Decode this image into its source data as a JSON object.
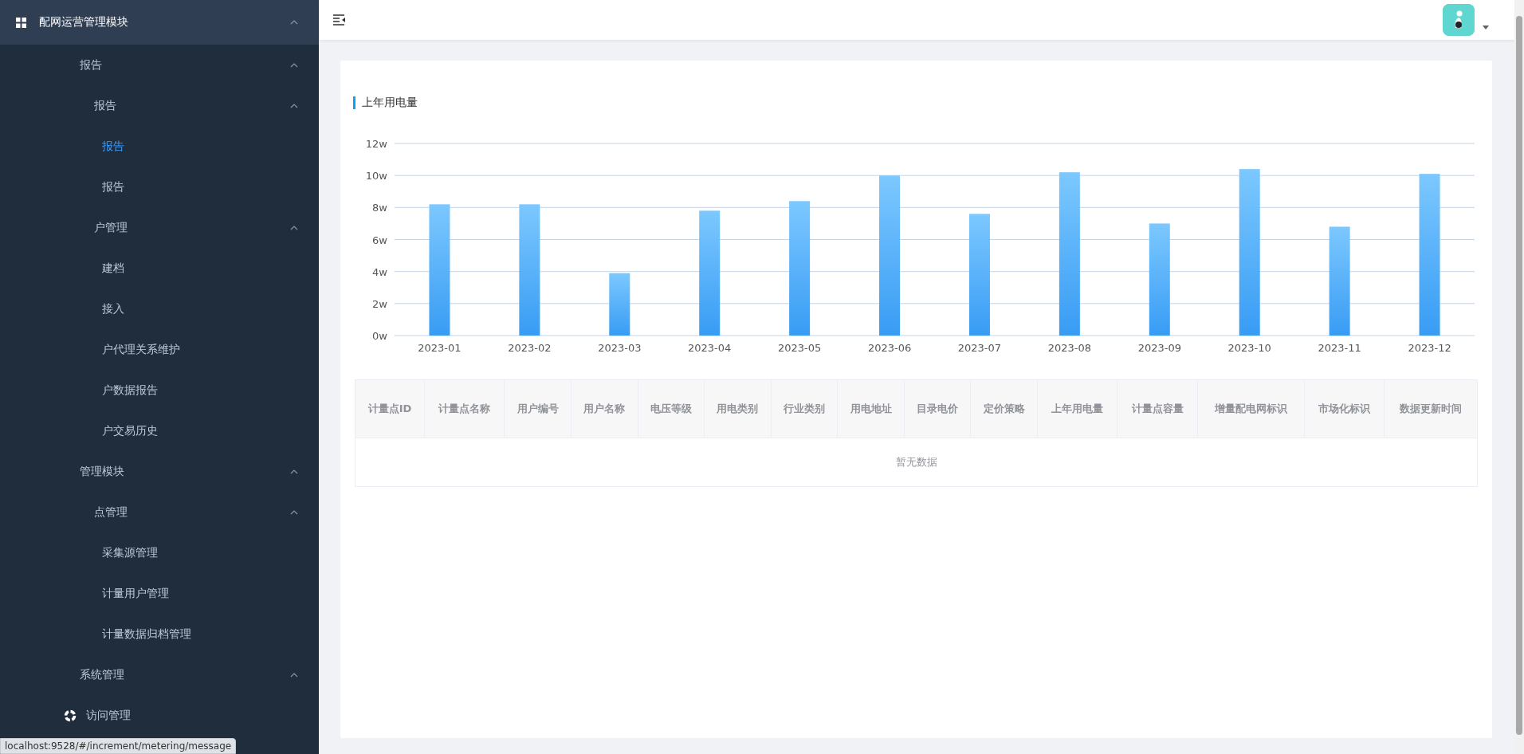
{
  "sidebar": {
    "items": [
      {
        "label": "配网运营管理模块",
        "expanded": true,
        "children": [
          {
            "label": "报告",
            "expanded": true,
            "children": [
              {
                "label": "报告",
                "expanded": true,
                "children": [
                  {
                    "label": "报告",
                    "selected": true
                  },
                  {
                    "label": "报告",
                    "selected": false
                  }
                ]
              },
              {
                "label": "户管理",
                "expanded": true,
                "children": [
                  {
                    "label": "建档",
                    "selected": false
                  },
                  {
                    "label": "接入",
                    "selected": false
                  },
                  {
                    "label": "户代理关系维护",
                    "selected": false
                  },
                  {
                    "label": "户数据报告",
                    "selected": false
                  },
                  {
                    "label": "户交易历史",
                    "selected": false
                  }
                ]
              }
            ]
          },
          {
            "label": "管理模块",
            "expanded": true,
            "children": [
              {
                "label": "点管理",
                "expanded": true,
                "children": [
                  {
                    "label": "采集源管理",
                    "selected": false
                  },
                  {
                    "label": "计量用户管理",
                    "selected": false
                  },
                  {
                    "label": "计量数据归档管理",
                    "selected": false
                  }
                ]
              }
            ]
          },
          {
            "label": "系统管理",
            "expanded": true,
            "children": [
              {
                "label": "访问管理",
                "selected": false
              }
            ]
          }
        ]
      }
    ]
  },
  "card": {
    "title": "上年用电量",
    "chart_data": {
      "type": "bar",
      "categories": [
        "2023-01",
        "2023-02",
        "2023-03",
        "2023-04",
        "2023-05",
        "2023-06",
        "2023-07",
        "2023-08",
        "2023-09",
        "2023-10",
        "2023-11",
        "2023-12"
      ],
      "values": [
        8.2,
        8.2,
        3.9,
        7.8,
        8.4,
        10.0,
        7.6,
        10.2,
        7.0,
        10.4,
        6.8,
        10.1
      ],
      "ylim": [
        0,
        12
      ],
      "grid": true,
      "yticks": [
        {
          "value": 0,
          "label": "0w"
        },
        {
          "value": 2,
          "label": "2w"
        },
        {
          "value": 4,
          "label": "4w"
        },
        {
          "value": 6,
          "label": "6w"
        },
        {
          "value": 8,
          "label": "8w"
        },
        {
          "value": 10,
          "label": "10w"
        },
        {
          "value": 12,
          "label": "12w"
        }
      ]
    },
    "table": {
      "columns": [
        "计量点ID",
        "计量点名称",
        "用户编号",
        "用户名称",
        "电压等级",
        "用电类别",
        "行业类别",
        "用电地址",
        "目录电价",
        "定价策略",
        "上年用电量",
        "计量点容量",
        "增量配电网标识",
        "市场化标识",
        "数据更新时间"
      ],
      "empty_text": "暂无数据"
    }
  },
  "status_bar": "localhost:9528/#/increment/metering/message"
}
